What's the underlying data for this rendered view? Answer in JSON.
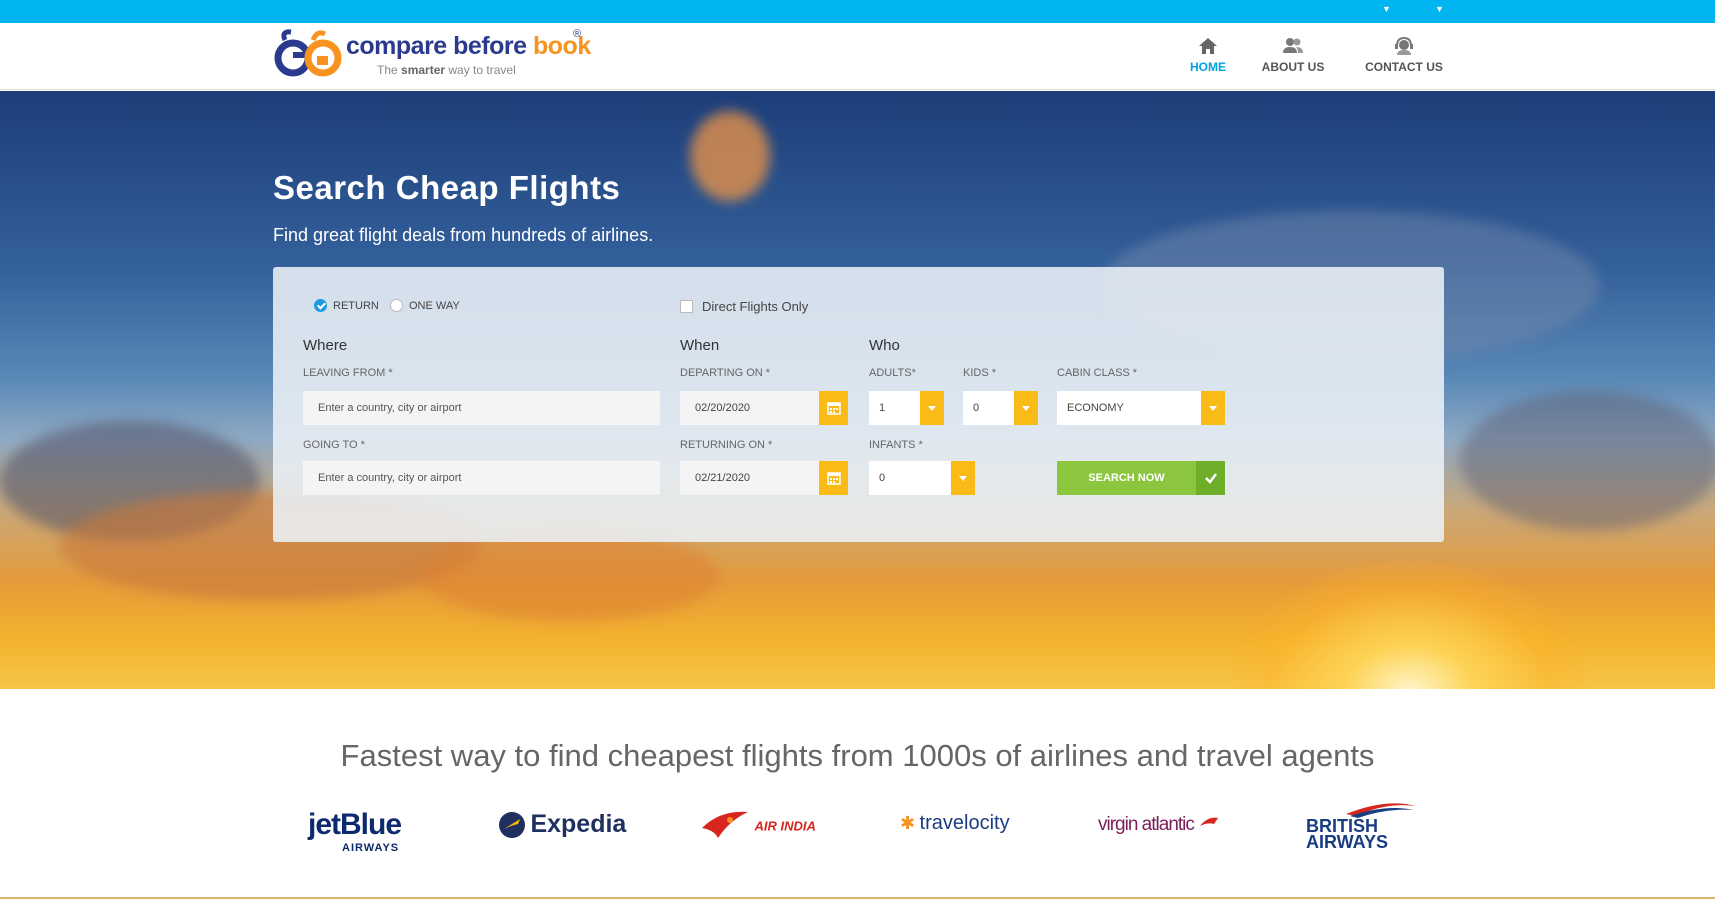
{
  "colors": {
    "topbar": "#00b4ef",
    "accent": "#00a2e2",
    "date_button": "#fbbb17",
    "search_button": "#8cc63f"
  },
  "brand": {
    "name_part1": "compare before ",
    "name_part2": "book",
    "reg": "®",
    "tagline_pre": "The ",
    "tagline_bold": "smarter",
    "tagline_post": " way to travel"
  },
  "nav": [
    {
      "label": "HOME",
      "icon": "home-icon",
      "active": true
    },
    {
      "label": "ABOUT US",
      "icon": "users-icon",
      "active": false
    },
    {
      "label": "CONTACT US",
      "icon": "support-agent-icon",
      "active": false
    }
  ],
  "hero": {
    "title": "Search Cheap Flights",
    "subtitle": "Find great flight deals from hundreds of airlines."
  },
  "form": {
    "trip_return": "RETURN",
    "trip_oneway": "ONE WAY",
    "direct_only": "Direct Flights Only",
    "where_heading": "Where",
    "when_heading": "When",
    "who_heading": "Who",
    "leaving_label": "LEAVING FROM *",
    "leaving_placeholder": "Enter a country, city or airport",
    "going_label": "GOING TO *",
    "going_placeholder": "Enter a country, city or airport",
    "departing_label": "DEPARTING ON *",
    "departing_value": "02/20/2020",
    "returning_label": "RETURNING ON *",
    "returning_value": "02/21/2020",
    "adults_label": "ADULTS*",
    "adults_value": "1",
    "kids_label": "KIDS *",
    "kids_value": "0",
    "infants_label": "INFANTS *",
    "infants_value": "0",
    "cabin_label": "CABIN CLASS *",
    "cabin_value": "ECONOMY",
    "search_label": "SEARCH NOW"
  },
  "partners": {
    "heading": "Fastest way to find cheapest flights from 1000s of airlines and travel agents",
    "jetblue": "jetBlue",
    "jetblue_sub": "AIRWAYS",
    "expedia": "Expedia",
    "airindia": "AIR INDIA",
    "travelocity": "travelocity",
    "virgin": "virgin atlantic",
    "ba_1": "BRITISH",
    "ba_2": "AIRWAYS"
  }
}
